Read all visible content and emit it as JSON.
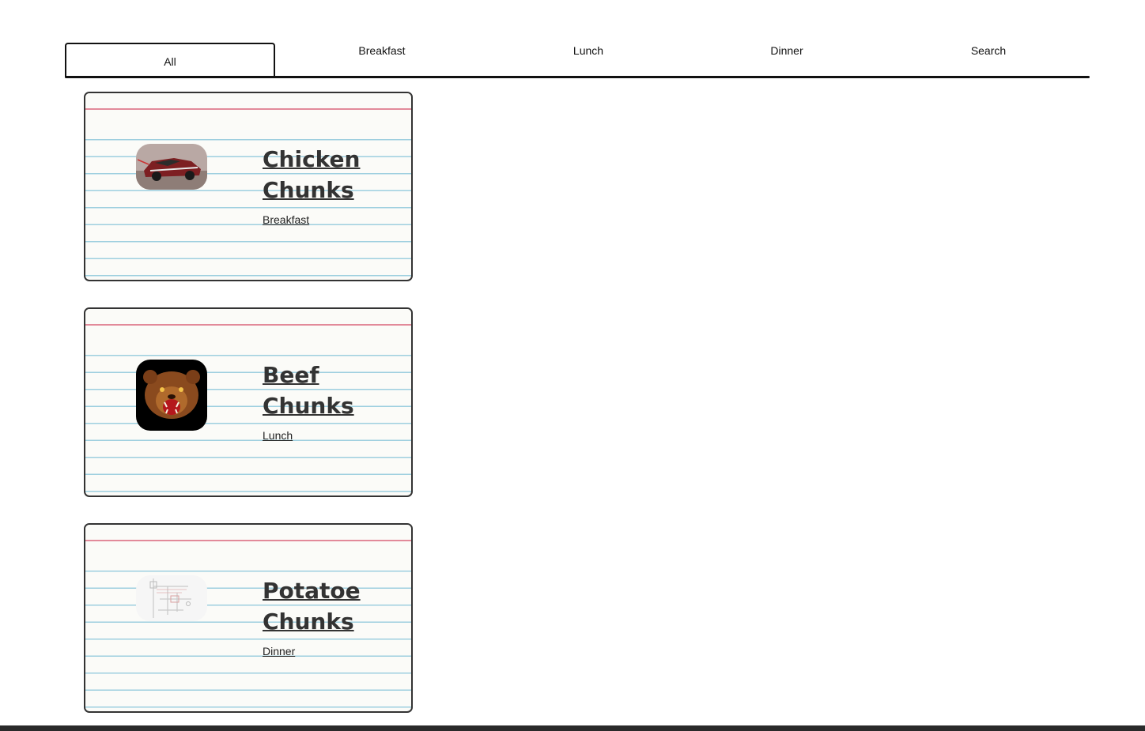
{
  "tabs": [
    {
      "label": "All",
      "active": true
    },
    {
      "label": "Breakfast",
      "active": false
    },
    {
      "label": "Lunch",
      "active": false
    },
    {
      "label": "Dinner",
      "active": false
    },
    {
      "label": "Search",
      "active": false
    }
  ],
  "recipes": [
    {
      "title": "Chicken Chunks",
      "category": "Breakfast",
      "image_icon": "race-car-photo"
    },
    {
      "title": "Beef Chunks",
      "category": "Lunch",
      "image_icon": "bear-illustration"
    },
    {
      "title": "Potatoe Chunks",
      "category": "Dinner",
      "image_icon": "diagram-sketch"
    }
  ],
  "colors": {
    "card_rule_blue": "#9ecfdf",
    "card_margin_red": "#e28a9a",
    "border": "#333333"
  }
}
